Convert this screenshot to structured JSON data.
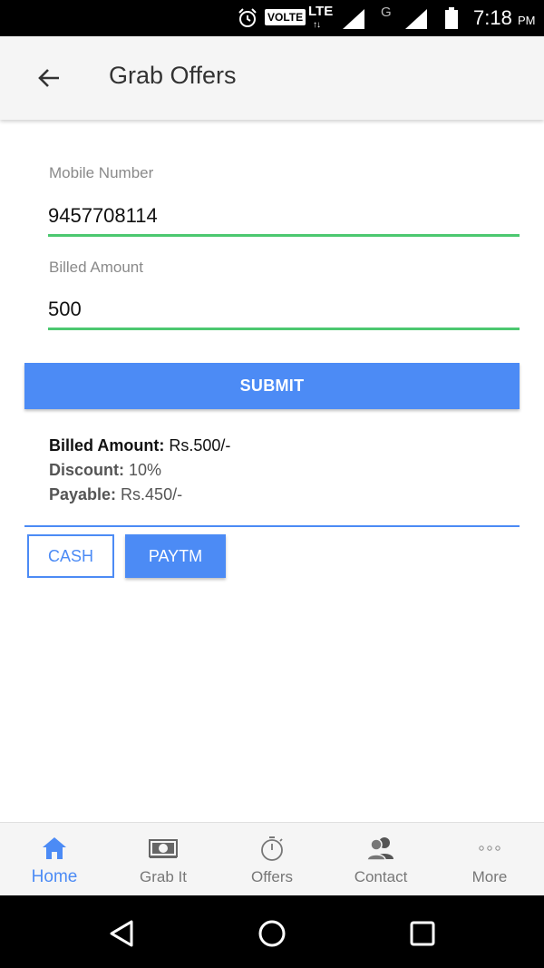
{
  "status_bar": {
    "volte": "VOLTE",
    "network": "LTE",
    "network_arrows": "↑↓",
    "g_label": "G",
    "time": "7:18",
    "ampm": "PM"
  },
  "app_bar": {
    "title": "Grab Offers"
  },
  "form": {
    "mobile_label": "Mobile Number",
    "mobile_value": "9457708114",
    "amount_label": "Billed Amount",
    "amount_value": "500",
    "submit_label": "SUBMIT"
  },
  "summary": {
    "billed_label": "Billed Amount:",
    "billed_value": " Rs.500/-",
    "discount_label": "Discount:",
    "discount_value": " 10%",
    "payable_label": "Payable:",
    "payable_value": " Rs.450/-"
  },
  "payment": {
    "cash_label": "CASH",
    "paytm_label": "PAYTM"
  },
  "bottom_nav": {
    "items": [
      {
        "label": "Home",
        "icon": "home-icon",
        "active": true
      },
      {
        "label": "Grab It",
        "icon": "cash-icon",
        "active": false
      },
      {
        "label": "Offers",
        "icon": "stopwatch-icon",
        "active": false
      },
      {
        "label": "Contact",
        "icon": "contacts-icon",
        "active": false
      },
      {
        "label": "More",
        "icon": "more-icon",
        "active": false
      }
    ]
  },
  "colors": {
    "accent": "#4c8bf5",
    "input_underline": "#4cc870",
    "appbar": "#f5f5f5"
  }
}
